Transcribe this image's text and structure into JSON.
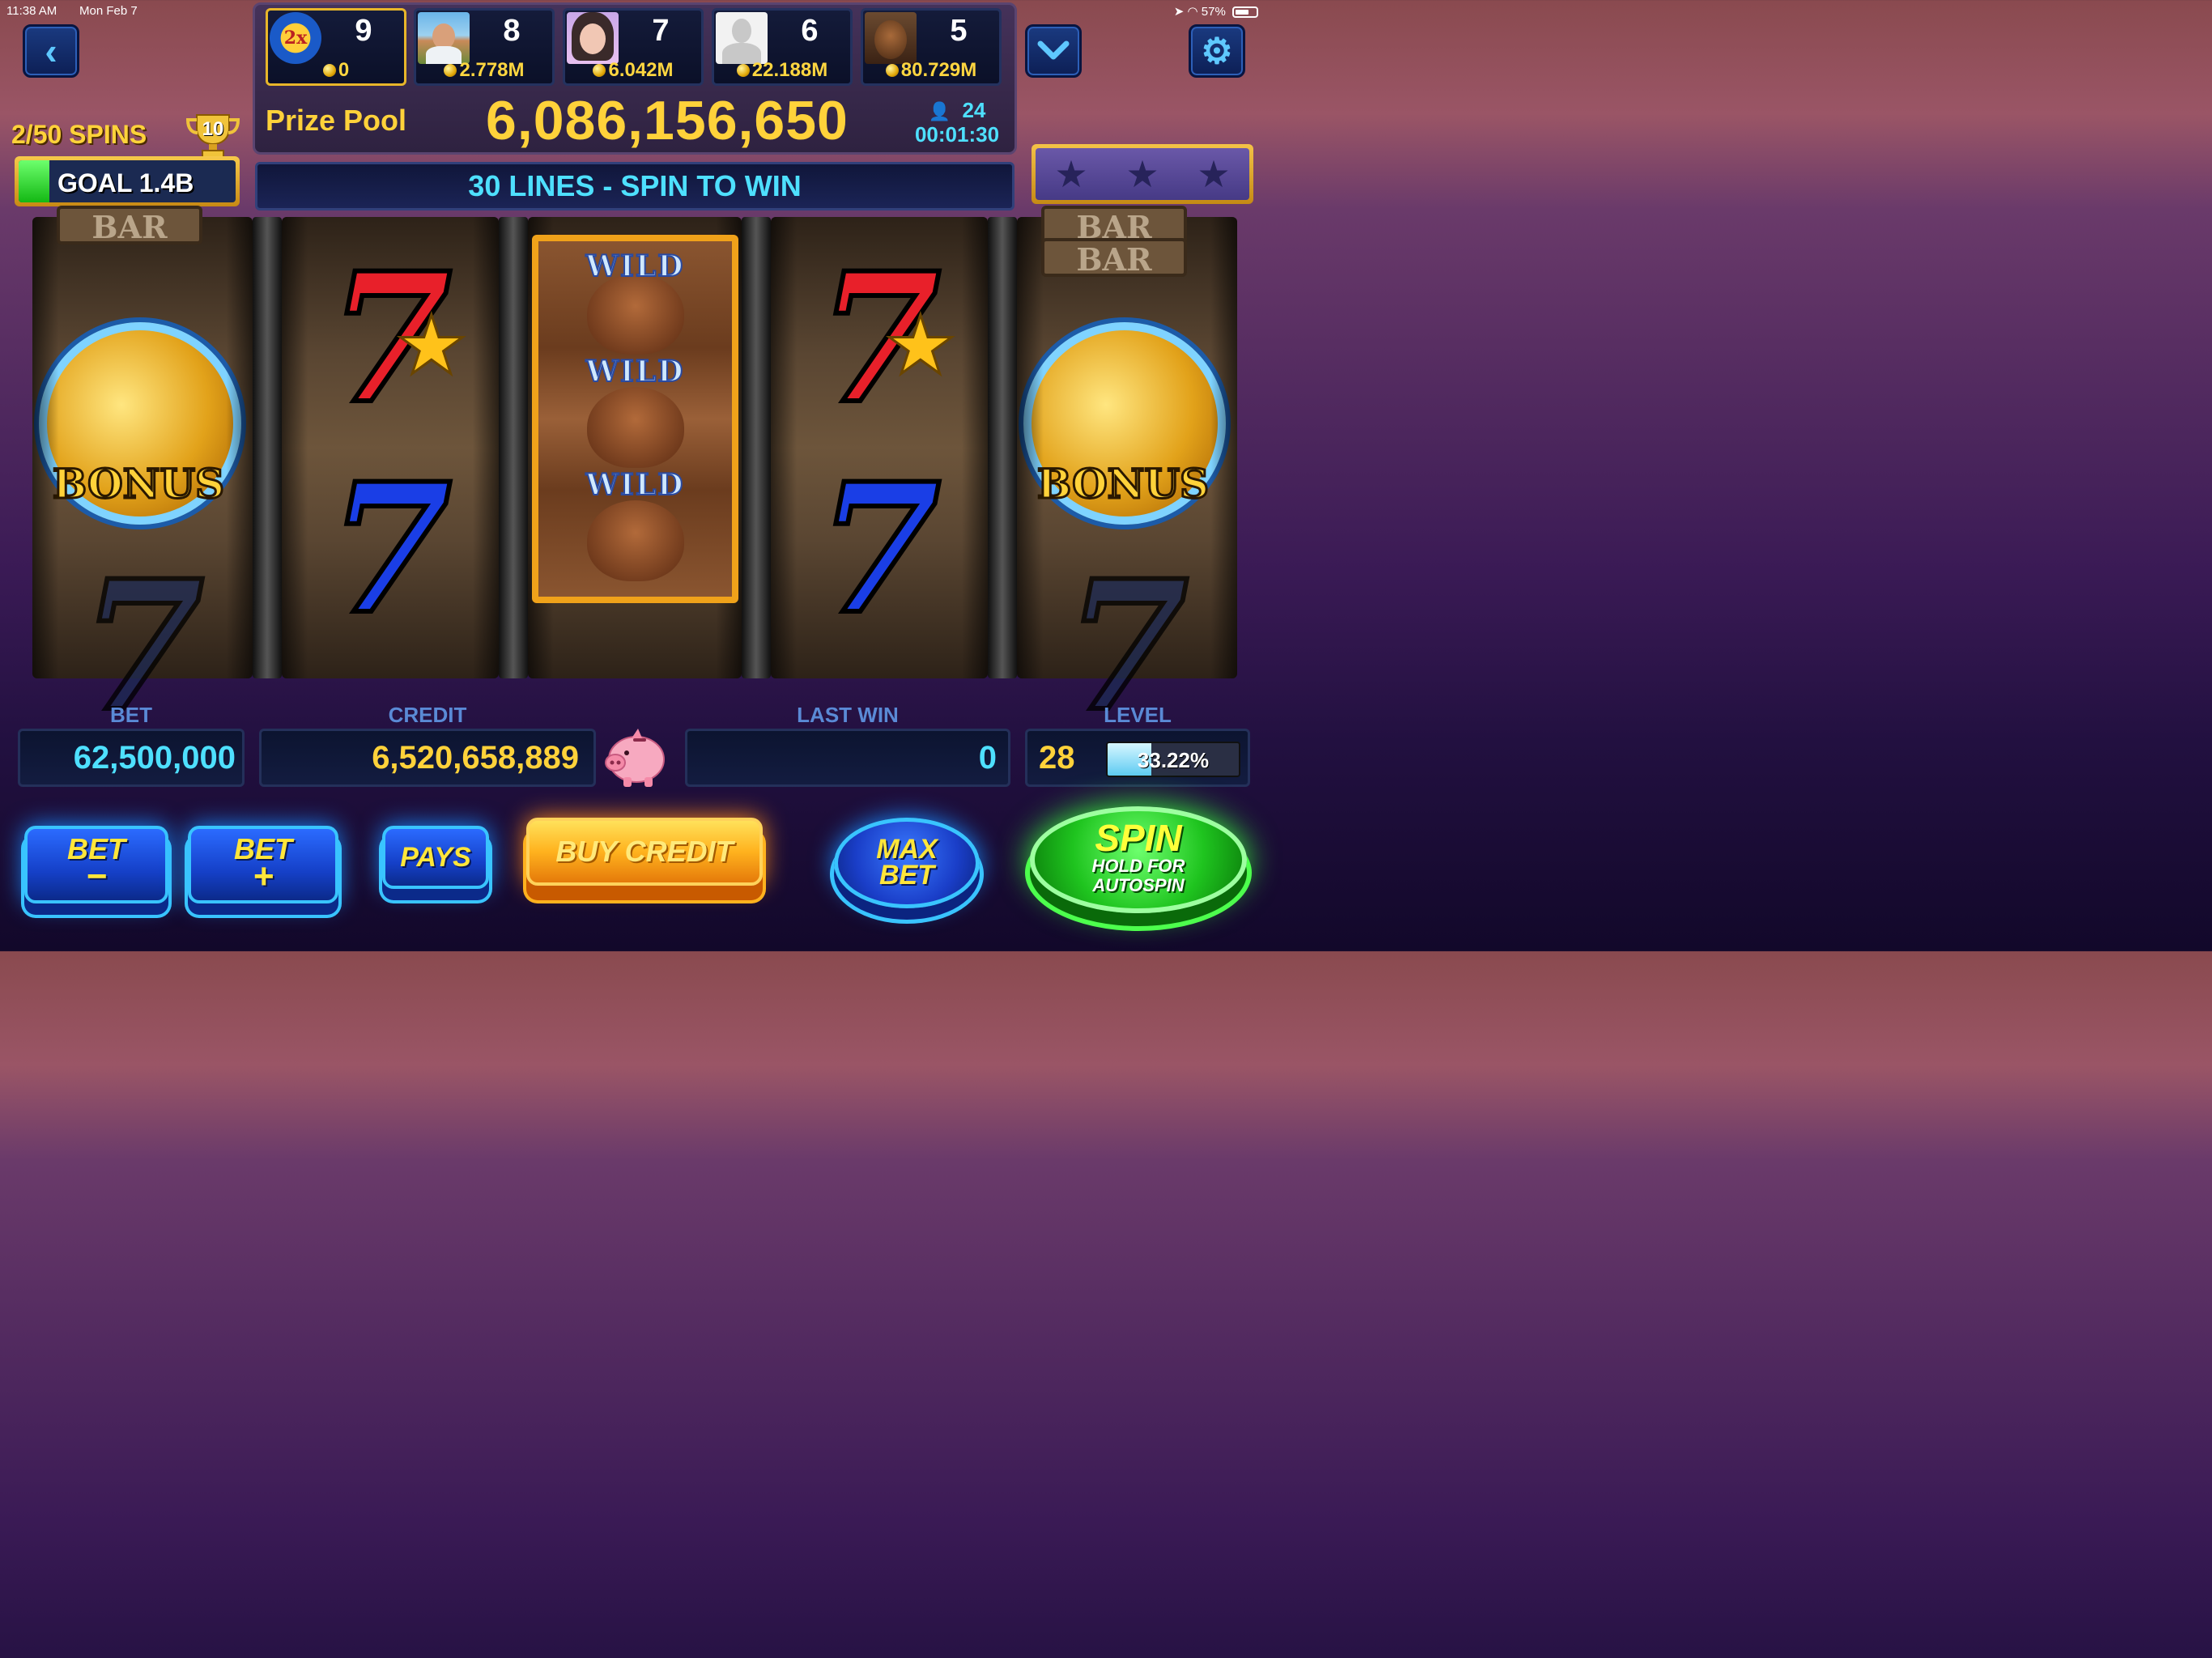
{
  "status_bar": {
    "time": "11:38 AM",
    "date": "Mon Feb 7",
    "battery": "57%"
  },
  "nav": {
    "back_icon": "‹",
    "dropdown_icon": "⌄",
    "settings_icon": "⚙"
  },
  "leaderboard": [
    {
      "rank": "9",
      "coins": "0",
      "avatar": "2x-badge"
    },
    {
      "rank": "8",
      "coins": "2.778M",
      "avatar": "man-photo"
    },
    {
      "rank": "7",
      "coins": "6.042M",
      "avatar": "woman-photo"
    },
    {
      "rank": "6",
      "coins": "22.188M",
      "avatar": "default-avatar"
    },
    {
      "rank": "5",
      "coins": "80.729M",
      "avatar": "buffalo-photo"
    }
  ],
  "avatar_badge_text": "2x",
  "prize_pool": {
    "label": "Prize Pool",
    "value": "6,086,156,650"
  },
  "players_online": {
    "count": "24",
    "timer": "00:01:30"
  },
  "spins": {
    "label": "2/50 SPINS",
    "trophy_value": "10"
  },
  "goal": {
    "label": "GOAL 1.4B",
    "progress": 0.14
  },
  "banner": "30 LINES - SPIN TO WIN",
  "stars": [
    "★",
    "★",
    "★"
  ],
  "reels": {
    "symbols": {
      "seven": "7",
      "bar": "BAR",
      "bonus": "BONUS",
      "wild": "WILD",
      "star": "★"
    }
  },
  "info": {
    "bet_label": "BET",
    "bet_value": "62,500,000",
    "credit_label": "CREDIT",
    "credit_value": "6,520,658,889",
    "last_win_label": "LAST WIN",
    "last_win_value": "0",
    "level_label": "LEVEL",
    "level_value": "28",
    "level_progress": "33.22%"
  },
  "buttons": {
    "bet_minus": "BET\n−",
    "bet_minus_top": "BET",
    "bet_minus_bottom": "−",
    "bet_plus_top": "BET",
    "bet_plus_bottom": "+",
    "pays": "PAYS",
    "buy_credit": "BUY CREDIT",
    "max_bet_top": "MAX",
    "max_bet_bottom": "BET",
    "spin_top": "SPIN",
    "spin_sub1": "HOLD FOR",
    "spin_sub2": "AUTOSPIN"
  },
  "colors": {
    "gold": "#ffd23a",
    "cyan": "#4ee0ff",
    "accent_blue": "#5a8ad6"
  }
}
